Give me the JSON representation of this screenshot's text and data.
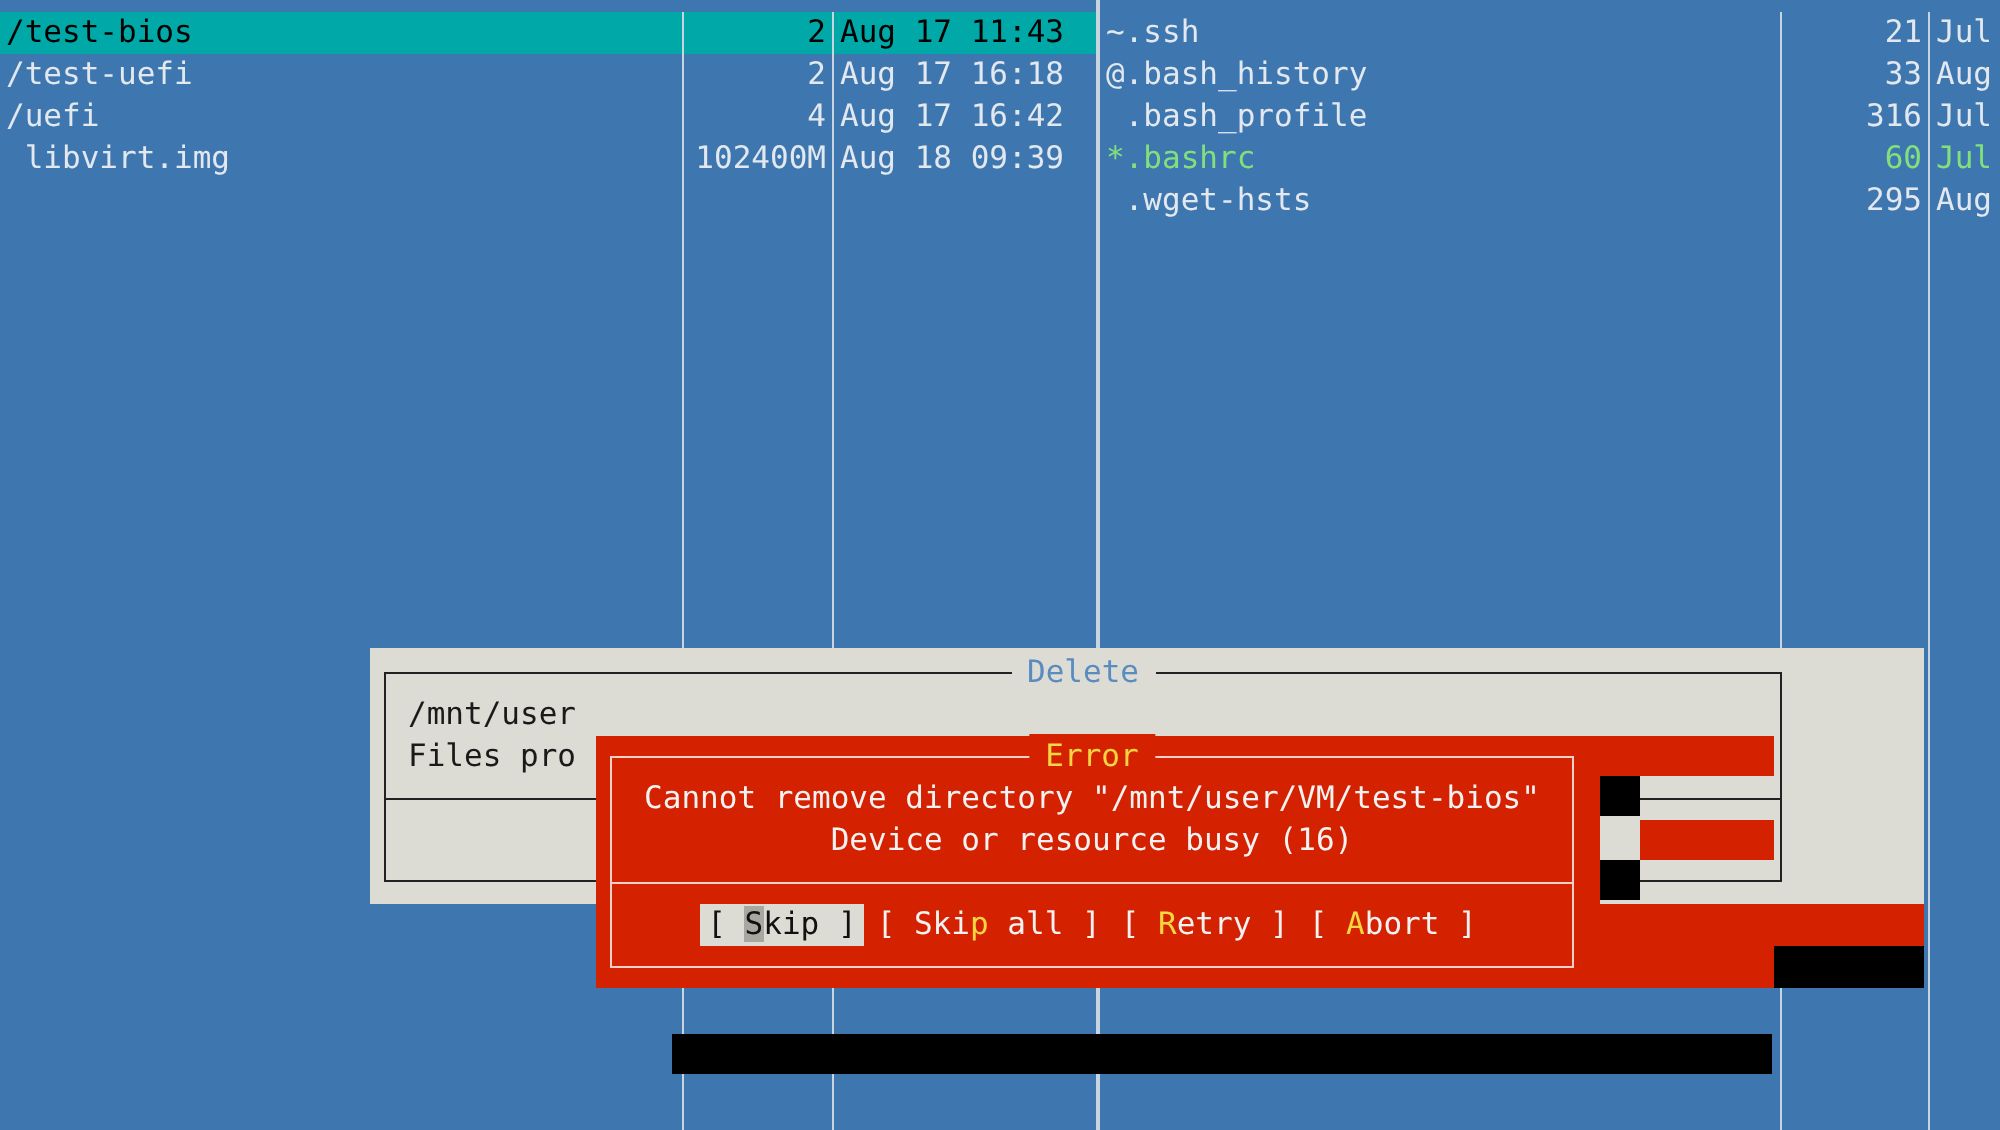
{
  "left_panel": {
    "rows": [
      {
        "name": "/test-bios",
        "size": "2",
        "modified": "Aug 17 11:43",
        "selected": true
      },
      {
        "name": "/test-uefi",
        "size": "2",
        "modified": "Aug 17 16:18",
        "selected": false
      },
      {
        "name": "/uefi",
        "size": "4",
        "modified": "Aug 17 16:42",
        "selected": false
      },
      {
        "name": " libvirt.img",
        "size": "102400M",
        "modified": "Aug 18 09:39",
        "selected": false
      }
    ]
  },
  "right_panel": {
    "rows": [
      {
        "name": "~.ssh",
        "size": "21",
        "modified": "Jul",
        "selected": false,
        "executable": false
      },
      {
        "name": "@.bash_history",
        "size": "33",
        "modified": "Aug",
        "selected": false,
        "executable": false
      },
      {
        "name": " .bash_profile",
        "size": "316",
        "modified": "Jul",
        "selected": false,
        "executable": false
      },
      {
        "name": "*.bashrc",
        "size": "60",
        "modified": "Jul",
        "selected": false,
        "executable": true
      },
      {
        "name": " .wget-hsts",
        "size": "295",
        "modified": "Aug",
        "selected": false,
        "executable": false
      }
    ]
  },
  "delete_dialog": {
    "title": "Delete",
    "lines": [
      "/mnt/user",
      "Files pro"
    ]
  },
  "error_dialog": {
    "title": "Error",
    "lines": [
      "Cannot remove directory \"/mnt/user/VM/test-bios\"",
      "Device or resource busy (16)"
    ],
    "buttons": [
      {
        "pre": "[ ",
        "key": "S",
        "post": "kip ]",
        "selected": true
      },
      {
        "pre": "[ Ski",
        "key": "p",
        "post": " all ]",
        "selected": false
      },
      {
        "pre": "[ ",
        "key": "R",
        "post": "etry ]",
        "selected": false
      },
      {
        "pre": "[ ",
        "key": "A",
        "post": "bort ]",
        "selected": false
      }
    ]
  }
}
